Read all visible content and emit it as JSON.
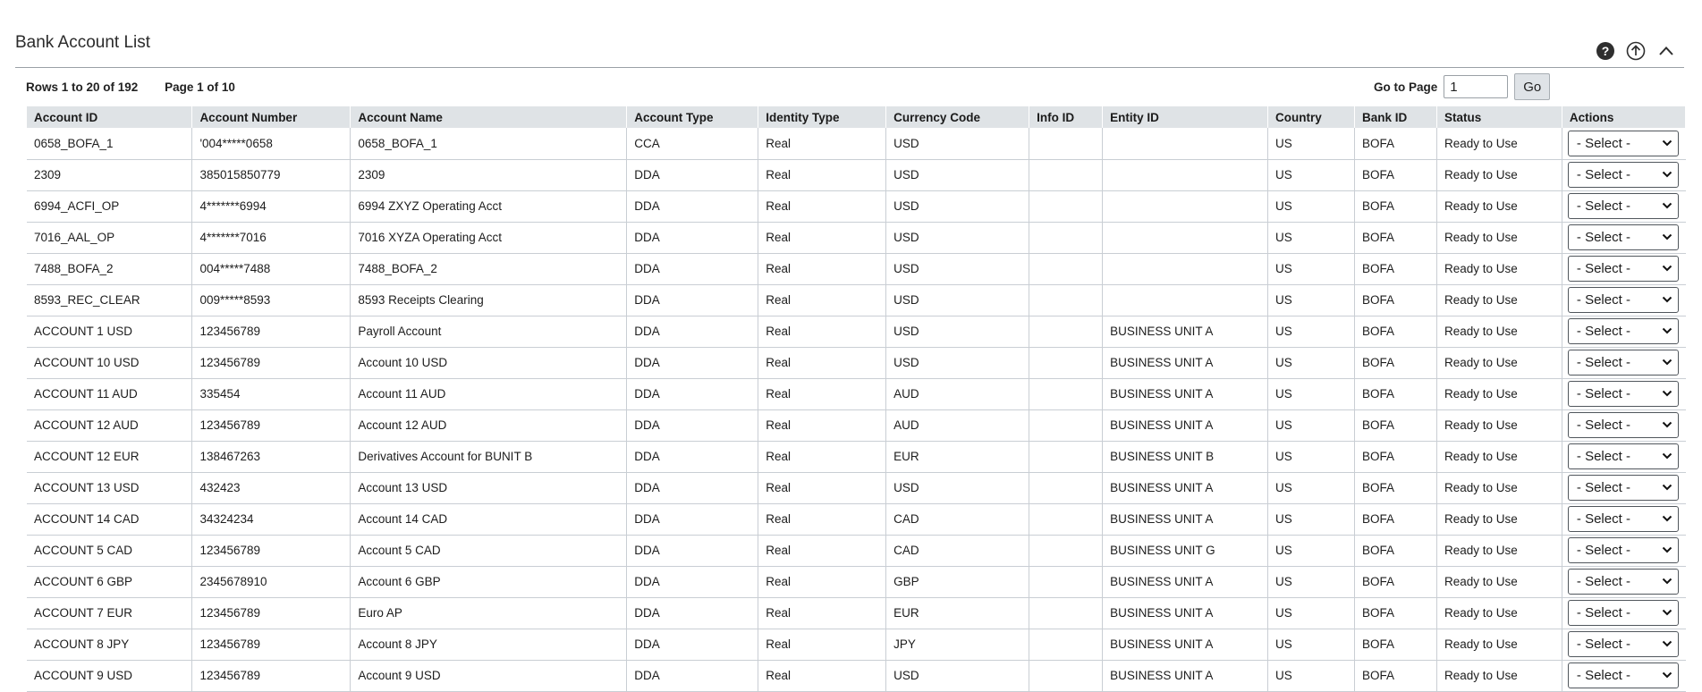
{
  "page": {
    "title": "Bank Account List"
  },
  "header_icons": [
    {
      "name": "help-icon"
    },
    {
      "name": "upload-icon"
    },
    {
      "name": "collapse-icon"
    }
  ],
  "pager": {
    "rows_text": "Rows 1 to 20 of 192",
    "page_text": "Page 1 of 10",
    "goto_label": "Go to Page",
    "goto_value": "1",
    "go_button": "Go"
  },
  "table": {
    "columns": [
      "Account ID",
      "Account Number",
      "Account Name",
      "Account Type",
      "Identity Type",
      "Currency Code",
      "Info ID",
      "Entity ID",
      "Country",
      "Bank ID",
      "Status",
      "Actions"
    ],
    "select_placeholder": "- Select -",
    "rows": [
      [
        "0658_BOFA_1",
        "'004*****0658",
        "0658_BOFA_1",
        "CCA",
        "Real",
        "USD",
        "",
        "",
        "US",
        "BOFA",
        "Ready to Use"
      ],
      [
        "2309",
        "385015850779",
        "2309",
        "DDA",
        "Real",
        "USD",
        "",
        "",
        "US",
        "BOFA",
        "Ready to Use"
      ],
      [
        "6994_ACFI_OP",
        "4*******6994",
        "6994 ZXYZ Operating Acct",
        "DDA",
        "Real",
        "USD",
        "",
        "",
        "US",
        "BOFA",
        "Ready to Use"
      ],
      [
        "7016_AAL_OP",
        "4*******7016",
        "7016 XYZA Operating Acct",
        "DDA",
        "Real",
        "USD",
        "",
        "",
        "US",
        "BOFA",
        "Ready to Use"
      ],
      [
        "7488_BOFA_2",
        "004*****7488",
        "7488_BOFA_2",
        "DDA",
        "Real",
        "USD",
        "",
        "",
        "US",
        "BOFA",
        "Ready to Use"
      ],
      [
        "8593_REC_CLEAR",
        "009*****8593",
        "8593 Receipts Clearing",
        "DDA",
        "Real",
        "USD",
        "",
        "",
        "US",
        "BOFA",
        "Ready to Use"
      ],
      [
        "ACCOUNT 1 USD",
        "123456789",
        "Payroll Account",
        "DDA",
        "Real",
        "USD",
        "",
        "BUSINESS UNIT A",
        "US",
        "BOFA",
        "Ready to Use"
      ],
      [
        "ACCOUNT 10 USD",
        "123456789",
        "Account 10 USD",
        "DDA",
        "Real",
        "USD",
        "",
        "BUSINESS UNIT A",
        "US",
        "BOFA",
        "Ready to Use"
      ],
      [
        "ACCOUNT 11 AUD",
        "335454",
        "Account 11 AUD",
        "DDA",
        "Real",
        "AUD",
        "",
        "BUSINESS UNIT A",
        "US",
        "BOFA",
        "Ready to Use"
      ],
      [
        "ACCOUNT 12 AUD",
        "123456789",
        "Account 12 AUD",
        "DDA",
        "Real",
        "AUD",
        "",
        "BUSINESS UNIT A",
        "US",
        "BOFA",
        "Ready to Use"
      ],
      [
        "ACCOUNT 12 EUR",
        "138467263",
        "Derivatives Account for BUNIT B",
        "DDA",
        "Real",
        "EUR",
        "",
        "BUSINESS UNIT B",
        "US",
        "BOFA",
        "Ready to Use"
      ],
      [
        "ACCOUNT 13 USD",
        "432423",
        "Account 13 USD",
        "DDA",
        "Real",
        "USD",
        "",
        "BUSINESS UNIT A",
        "US",
        "BOFA",
        "Ready to Use"
      ],
      [
        "ACCOUNT 14 CAD",
        "34324234",
        "Account 14 CAD",
        "DDA",
        "Real",
        "CAD",
        "",
        "BUSINESS UNIT A",
        "US",
        "BOFA",
        "Ready to Use"
      ],
      [
        "ACCOUNT 5 CAD",
        "123456789",
        "Account 5 CAD",
        "DDA",
        "Real",
        "CAD",
        "",
        "BUSINESS UNIT G",
        "US",
        "BOFA",
        "Ready to Use"
      ],
      [
        "ACCOUNT 6 GBP",
        "2345678910",
        "Account 6 GBP",
        "DDA",
        "Real",
        "GBP",
        "",
        "BUSINESS UNIT A",
        "US",
        "BOFA",
        "Ready to Use"
      ],
      [
        "ACCOUNT 7 EUR",
        "123456789",
        "Euro AP",
        "DDA",
        "Real",
        "EUR",
        "",
        "BUSINESS UNIT A",
        "US",
        "BOFA",
        "Ready to Use"
      ],
      [
        "ACCOUNT 8 JPY",
        "123456789",
        "Account 8 JPY",
        "DDA",
        "Real",
        "JPY",
        "",
        "BUSINESS UNIT A",
        "US",
        "BOFA",
        "Ready to Use"
      ],
      [
        "ACCOUNT 9 USD",
        "123456789",
        "Account 9 USD",
        "DDA",
        "Real",
        "USD",
        "",
        "BUSINESS UNIT A",
        "US",
        "BOFA",
        "Ready to Use"
      ]
    ]
  }
}
